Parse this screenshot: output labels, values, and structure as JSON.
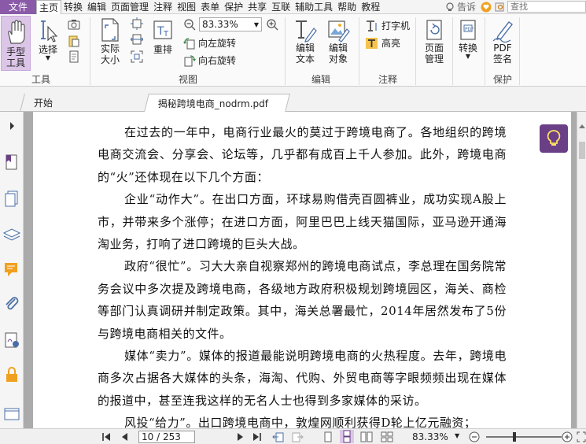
{
  "menu": {
    "file": "文件",
    "items": [
      "主页",
      "转换",
      "编辑",
      "页面管理",
      "注释",
      "视图",
      "表单",
      "保护",
      "共享",
      "互联",
      "辅助工具",
      "帮助",
      "教程"
    ],
    "active_index": 0,
    "tell_me": "告诉",
    "search_placeholder": "查找"
  },
  "ribbon": {
    "tools": {
      "hand": "手型\n工具",
      "select": "选择",
      "label": "工具"
    },
    "view": {
      "actual_size": "实际\n大小",
      "reflow": "重排",
      "zoom_value": "83.33%",
      "rotate_left": "向左旋转",
      "rotate_right": "向右旋转",
      "label": "视图"
    },
    "edit": {
      "edit_text": "编辑\n文本",
      "edit_object": "编辑\n对象",
      "label": "编辑"
    },
    "comment": {
      "typewriter": "打字机",
      "highlight": "高亮",
      "label": "注释"
    },
    "page": {
      "page_manage": "页面\n管理"
    },
    "convert": {
      "convert": "转换"
    },
    "protect": {
      "pdf_sign": "PDF\n签名",
      "label": "保护"
    }
  },
  "tabs": [
    {
      "label": "开始"
    },
    {
      "label": "揭秘跨境电商_nodrm.pdf"
    }
  ],
  "document": {
    "paragraphs": [
      "在过去的一年中，电商行业最火的莫过于跨境电商了。各地组织的跨境电商交流会、分享会、论坛等，几乎都有成百上千人参加。此外，跨境电商的“火”还体现在以下几个方面：",
      "企业“动作大”。在出口方面，环球易购借壳百圆裤业，成功实现A股上市，并带来多个涨停；在进口方面，阿里巴巴上线天猫国际，亚马逊开通海淘业务，打响了进口跨境的巨头大战。",
      "政府“很忙”。习大大亲自视察郑州的跨境电商试点，李总理在国务院常务会议中多次提及跨境电商，各级地方政府积极规划跨境园区，海关、商检等部门认真调研并制定政策。其中，海关总署最忙，2014年居然发布了5份与跨境电商相关的文件。",
      "媒体“卖力”。媒体的报道最能说明跨境电商的火热程度。去年，跨境电商多次占据各大媒体的头条，海淘、代购、外贸电商等字眼频频出现在媒体的报道中，甚至连我这样的无名人士也得到多家媒体的采访。",
      "风投“给力”。出口跨境电商中，敦煌网顺利获得D轮上亿元融资；"
    ]
  },
  "status": {
    "page_indicator": "10 / 253",
    "zoom": "83.33%"
  },
  "colors": {
    "accent": "#8a5aa8",
    "bulb_bg": "#6b3f86",
    "selected_tool": "#dcc6e8"
  }
}
